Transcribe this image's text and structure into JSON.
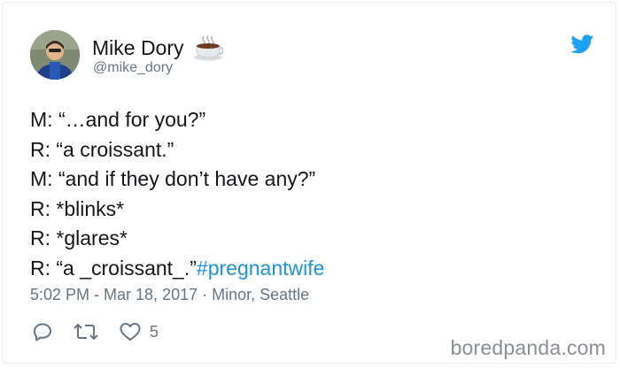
{
  "tweet": {
    "author_name": "Mike Dory",
    "author_emoji_icon": "coffee-icon",
    "handle": "@mike_dory",
    "lines": [
      "M: “…and for you?”",
      "R: “a croissant.”",
      "M: “and if they don’t have any?”",
      "R: *blinks*",
      "R: *glares*",
      "R: “a _croissant_.”"
    ],
    "hashtag": "#pregnantwife",
    "timestamp": "5:02 PM - Mar 18, 2017 · Minor, Seattle",
    "like_count": "5"
  },
  "icons": {
    "platform": "twitter-bird-icon",
    "reply": "reply-icon",
    "retweet": "retweet-icon",
    "like": "heart-icon"
  },
  "colors": {
    "link": "#1b95e0",
    "muted": "#657786",
    "text": "#14171a"
  },
  "watermark": "boredpanda.com"
}
